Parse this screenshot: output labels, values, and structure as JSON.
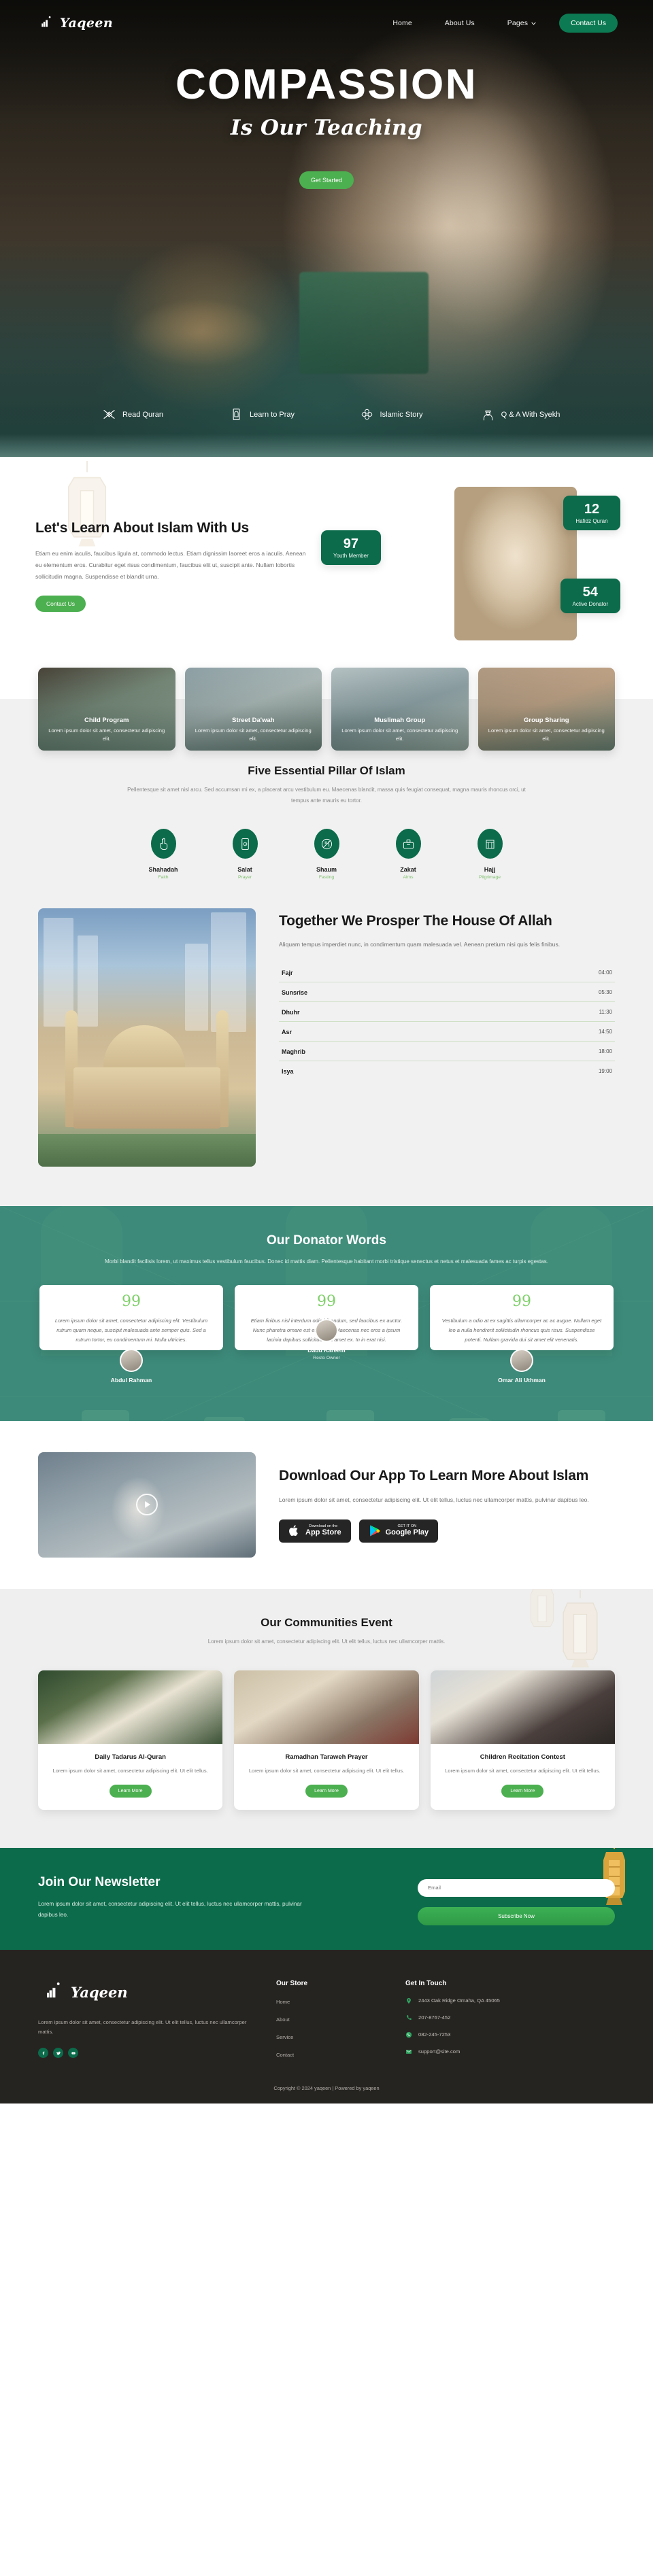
{
  "nav": {
    "brand": "Yaqeen",
    "links": [
      {
        "label": "Home"
      },
      {
        "label": "About Us"
      },
      {
        "label": "Pages"
      }
    ],
    "cta": "Contact Us"
  },
  "hero": {
    "title": "COMPASSION",
    "subtitle": "Is Our Teaching",
    "cta": "Get Started",
    "features": [
      {
        "label": "Read Quran",
        "icon": "quran-icon"
      },
      {
        "label": "Learn to Pray",
        "icon": "prayer-rug-icon"
      },
      {
        "label": "Islamic Story",
        "icon": "ornament-icon"
      },
      {
        "label": "Q & A With Syekh",
        "icon": "scholar-icon"
      }
    ]
  },
  "learn": {
    "title": "Let's Learn About Islam With Us",
    "body": "Etiam eu enim iaculis, faucibus ligula at, commodo lectus. Etiam dignissim laoreet eros a iaculis. Aenean eu elementum eros. Curabitur eget risus condimentum, faucibus elit ut, suscipit ante. Nullam lobortis sollicitudin magna. Suspendisse et blandit urna.",
    "cta": "Contact Us",
    "stats": [
      {
        "value": "97",
        "label": "Youth Member"
      },
      {
        "value": "12",
        "label": "Hafidz Quran"
      },
      {
        "value": "54",
        "label": "Active Donator"
      }
    ]
  },
  "programs": [
    {
      "title": "Child Program",
      "desc": "Lorem ipsum dolor sit amet, consectetur adipiscing elit."
    },
    {
      "title": "Street Da'wah",
      "desc": "Lorem ipsum dolor sit amet, consectetur adipiscing elit."
    },
    {
      "title": "Muslimah Group",
      "desc": "Lorem ipsum dolor sit amet, consectetur adipiscing elit."
    },
    {
      "title": "Group Sharing",
      "desc": "Lorem ipsum dolor sit amet, consectetur adipiscing elit."
    }
  ],
  "pillars": {
    "title": "Five Essential Pillar Of Islam",
    "subtitle": "Pellentesque sit amet nisl arcu. Sed accumsan mi ex, a placerat arcu vestibulum eu. Maecenas blandit, massa quis feugiat consequat, magna mauris rhoncus orci, ut tempus ante mauris eu tortor.",
    "items": [
      {
        "name": "Shahadah",
        "sub": "Faith",
        "icon": "hand-index-icon"
      },
      {
        "name": "Salat",
        "sub": "Prayer",
        "icon": "prayer-rug-icon"
      },
      {
        "name": "Shaum",
        "sub": "Fasting",
        "icon": "no-food-icon"
      },
      {
        "name": "Zakat",
        "sub": "Alms",
        "icon": "donation-box-icon"
      },
      {
        "name": "Hajj",
        "sub": "Pilgrimage",
        "icon": "kaaba-icon"
      }
    ]
  },
  "prayer": {
    "title": "Together We Prosper The House Of Allah",
    "desc": "Aliquam tempus imperdiet nunc, in condimentum quam malesuada vel. Aenean pretium nisi quis felis finibus.",
    "times": [
      {
        "name": "Fajr",
        "time": "04:00"
      },
      {
        "name": "Sunsrise",
        "time": "05:30"
      },
      {
        "name": "Dhuhr",
        "time": "11:30"
      },
      {
        "name": "Asr",
        "time": "14:50"
      },
      {
        "name": "Maghrib",
        "time": "18:00"
      },
      {
        "name": "Isya",
        "time": "19:00"
      }
    ]
  },
  "donator": {
    "title": "Our Donator Words",
    "subtitle": "Morbi blandit facilisis lorem, ut maximus tellus vestibulum faucibus. Donec id mattis diam.  Pellentesque habitant morbi tristique senectus et netus et malesuada fames ac turpis egestas.",
    "testimonials": [
      {
        "quote": "Lorem ipsum dolor sit amet, consectetur adipiscing elit. Vestibulum rutrum quam neque, suscipit malesuada ante semper quis. Sed a rutrum tortor, eu condimentum mi. Nulla ultricies.",
        "name": "Abdul Rahman",
        "role": ""
      },
      {
        "quote": "Etiam finibus nisl interdum odio bibendum, sed faucibus ex auctor. Nunc pharetra ornare est et cursus. Maecenas nec eros a ipsum lacinia dapibus sollicitudin sit amet ex. In in erat nisi.",
        "name": "Daud Kareem",
        "role": "Resto Owner"
      },
      {
        "quote": "Vestibulum a odio at ex sagittis ullamcorper ac ac augue. Nullam eget leo a nulla hendrerit sollicitudin rhoncus quis risus. Suspendisse potenti. Nullam gravida dui sit amet elit venenatis.",
        "name": "Omar Ali Uthman",
        "role": ""
      }
    ]
  },
  "app": {
    "title": "Download Our App To Learn More About Islam",
    "desc": "Lorem ipsum dolor sit amet, consectetur adipiscing elit. Ut elit tellus, luctus nec ullamcorper mattis, pulvinar dapibus leo.",
    "stores": [
      {
        "small": "Download on the",
        "big": "App Store",
        "icon": "apple-icon"
      },
      {
        "small": "GET IT ON",
        "big": "Google Play",
        "icon": "google-play-icon"
      }
    ],
    "play_label": "play-button"
  },
  "events": {
    "title": "Our Communities Event",
    "subtitle": "Lorem ipsum dolor sit amet, consectetur adipiscing elit. Ut elit tellus, luctus nec ullamcorper mattis.",
    "cards": [
      {
        "title": "Daily Tadarus Al-Quran",
        "desc": "Lorem ipsum dolor sit amet, consectetur adipiscing elit. Ut elit tellus.",
        "cta": "Learn More"
      },
      {
        "title": "Ramadhan Taraweh Prayer",
        "desc": "Lorem ipsum dolor sit amet, consectetur adipiscing elit. Ut elit tellus.",
        "cta": "Learn More"
      },
      {
        "title": "Children Recitation Contest",
        "desc": "Lorem ipsum dolor sit amet, consectetur adipiscing elit. Ut elit tellus.",
        "cta": "Learn More"
      }
    ]
  },
  "newsletter": {
    "title": "Join Our Newsletter",
    "desc": "Lorem ipsum dolor sit amet, consectetur adipiscing elit. Ut elit tellus, luctus nec ullamcorper mattis, pulvinar dapibus leo.",
    "placeholder": "Email",
    "value": "",
    "cta": "Subscribe Now"
  },
  "footer": {
    "brand": "Yaqeen",
    "desc": "Lorem ipsum dolor sit amet, consectetur adipiscing elit. Ut elit tellus, luctus nec ullamcorper mattis.",
    "socials": [
      {
        "icon": "facebook-icon"
      },
      {
        "icon": "twitter-icon"
      },
      {
        "icon": "youtube-icon"
      }
    ],
    "store": {
      "heading": "Our Store",
      "links": [
        {
          "label": "Home"
        },
        {
          "label": "About"
        },
        {
          "label": "Service"
        },
        {
          "label": "Contact"
        }
      ]
    },
    "contact": {
      "heading": "Get In Touch",
      "items": [
        {
          "icon": "location-pin-icon",
          "text": "2443 Oak Ridge Omaha, QA 45065"
        },
        {
          "icon": "phone-icon",
          "text": "207-8767-452"
        },
        {
          "icon": "whatsapp-icon",
          "text": "082-245-7253"
        },
        {
          "icon": "envelope-icon",
          "text": "support@site.com"
        }
      ]
    },
    "copyright": "Copyright © 2024 yaqeen | Powered by yaqeen"
  },
  "colors": {
    "brand_green": "#0b6b4b",
    "accent_green": "#4caf50",
    "teal": "#3d8a7a",
    "dark": "#262421"
  }
}
